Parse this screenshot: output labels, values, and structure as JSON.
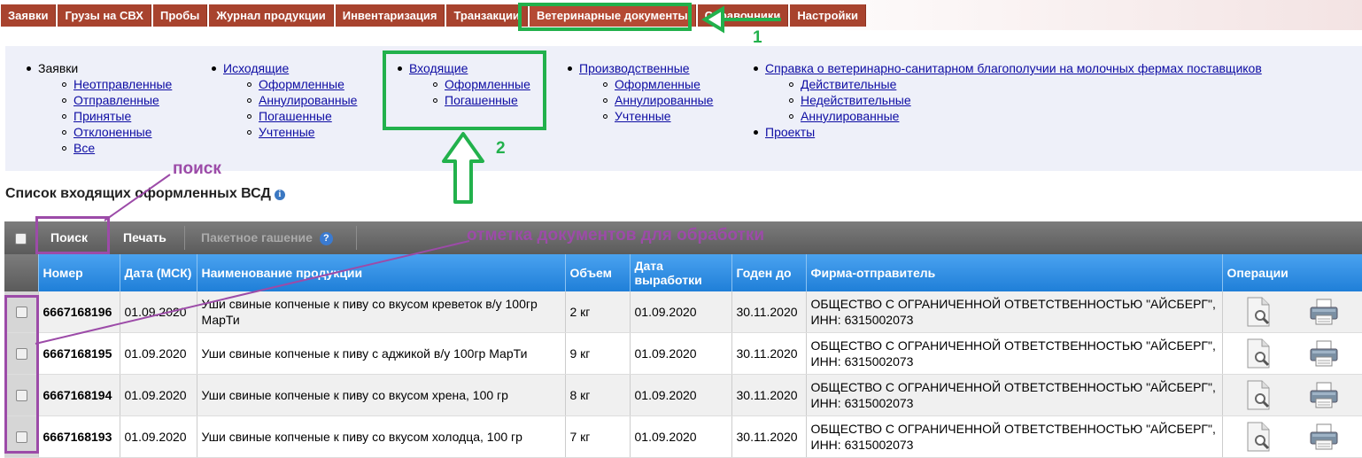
{
  "nav": {
    "tabs": [
      "Заявки",
      "Грузы на СВХ",
      "Пробы",
      "Журнал продукции",
      "Инвентаризация",
      "Транзакции",
      "Ветеринарные документы",
      "Справочники",
      "Настройки"
    ],
    "active_index": 6
  },
  "menu": {
    "col1": {
      "title": "Заявки",
      "items": [
        "Неотправленные",
        "Отправленные",
        "Принятые",
        "Отклоненные",
        "Все"
      ]
    },
    "col2": {
      "title": "Исходящие",
      "items": [
        "Оформленные",
        "Аннулированные",
        "Погашенные",
        "Учтенные"
      ]
    },
    "col3": {
      "title": "Входящие",
      "items": [
        "Оформленные",
        "Погашенные"
      ]
    },
    "col4": {
      "title": "Производственные",
      "items": [
        "Оформленные",
        "Аннулированные",
        "Учтенные"
      ]
    },
    "col5": {
      "title": "Справка о ветеринарно-санитарном благополучии на молочных фермах поставщиков",
      "items": [
        "Действительные",
        "Недействительные",
        "Аннулированные"
      ],
      "extra": "Проекты"
    }
  },
  "page": {
    "title": "Список входящих оформленных ВСД",
    "info_icon": "i"
  },
  "toolbar": {
    "search_label": "Поиск",
    "print_label": "Печать",
    "batch_label": "Пакетное гашение",
    "help_icon": "?"
  },
  "table": {
    "headers": [
      "Номер",
      "Дата (МСК)",
      "Наименование продукции",
      "Объем",
      "Дата выработки",
      "Годен до",
      "Фирма-отправитель",
      "Операции"
    ],
    "rows": [
      {
        "number": "6667168196",
        "date": "01.09.2020",
        "product": "Уши свиные копченые к пиву со вкусом креветок в/у 100гр МарТи",
        "volume": "2 кг",
        "produced": "01.09.2020",
        "expires": "30.11.2020",
        "sender": "ОБЩЕСТВО С ОГРАНИЧЕННОЙ ОТВЕТСТВЕННОСТЬЮ \"АЙСБЕРГ\", ИНН: 6315002073"
      },
      {
        "number": "6667168195",
        "date": "01.09.2020",
        "product": "Уши свиные копченые к пиву с аджикой в/у 100гр МарТи",
        "volume": "9 кг",
        "produced": "01.09.2020",
        "expires": "30.11.2020",
        "sender": "ОБЩЕСТВО С ОГРАНИЧЕННОЙ ОТВЕТСТВЕННОСТЬЮ \"АЙСБЕРГ\", ИНН: 6315002073"
      },
      {
        "number": "6667168194",
        "date": "01.09.2020",
        "product": "Уши свиные копченые к пиву со вкусом хрена, 100 гр",
        "volume": "8 кг",
        "produced": "01.09.2020",
        "expires": "30.11.2020",
        "sender": "ОБЩЕСТВО С ОГРАНИЧЕННОЙ ОТВЕТСТВЕННОСТЬЮ \"АЙСБЕРГ\", ИНН: 6315002073"
      },
      {
        "number": "6667168193",
        "date": "01.09.2020",
        "product": "Уши свиные копченые к пиву со вкусом холодца, 100 гр",
        "volume": "7 кг",
        "produced": "01.09.2020",
        "expires": "30.11.2020",
        "sender": "ОБЩЕСТВО С ОГРАНИЧЕННОЙ ОТВЕТСТВЕННОСТЬЮ \"АЙСБЕРГ\", ИНН: 6315002073"
      }
    ]
  },
  "annotations": {
    "label1": "1",
    "label2": "2",
    "search_note": "поиск",
    "mark_note": "отметка документов для обработки"
  }
}
